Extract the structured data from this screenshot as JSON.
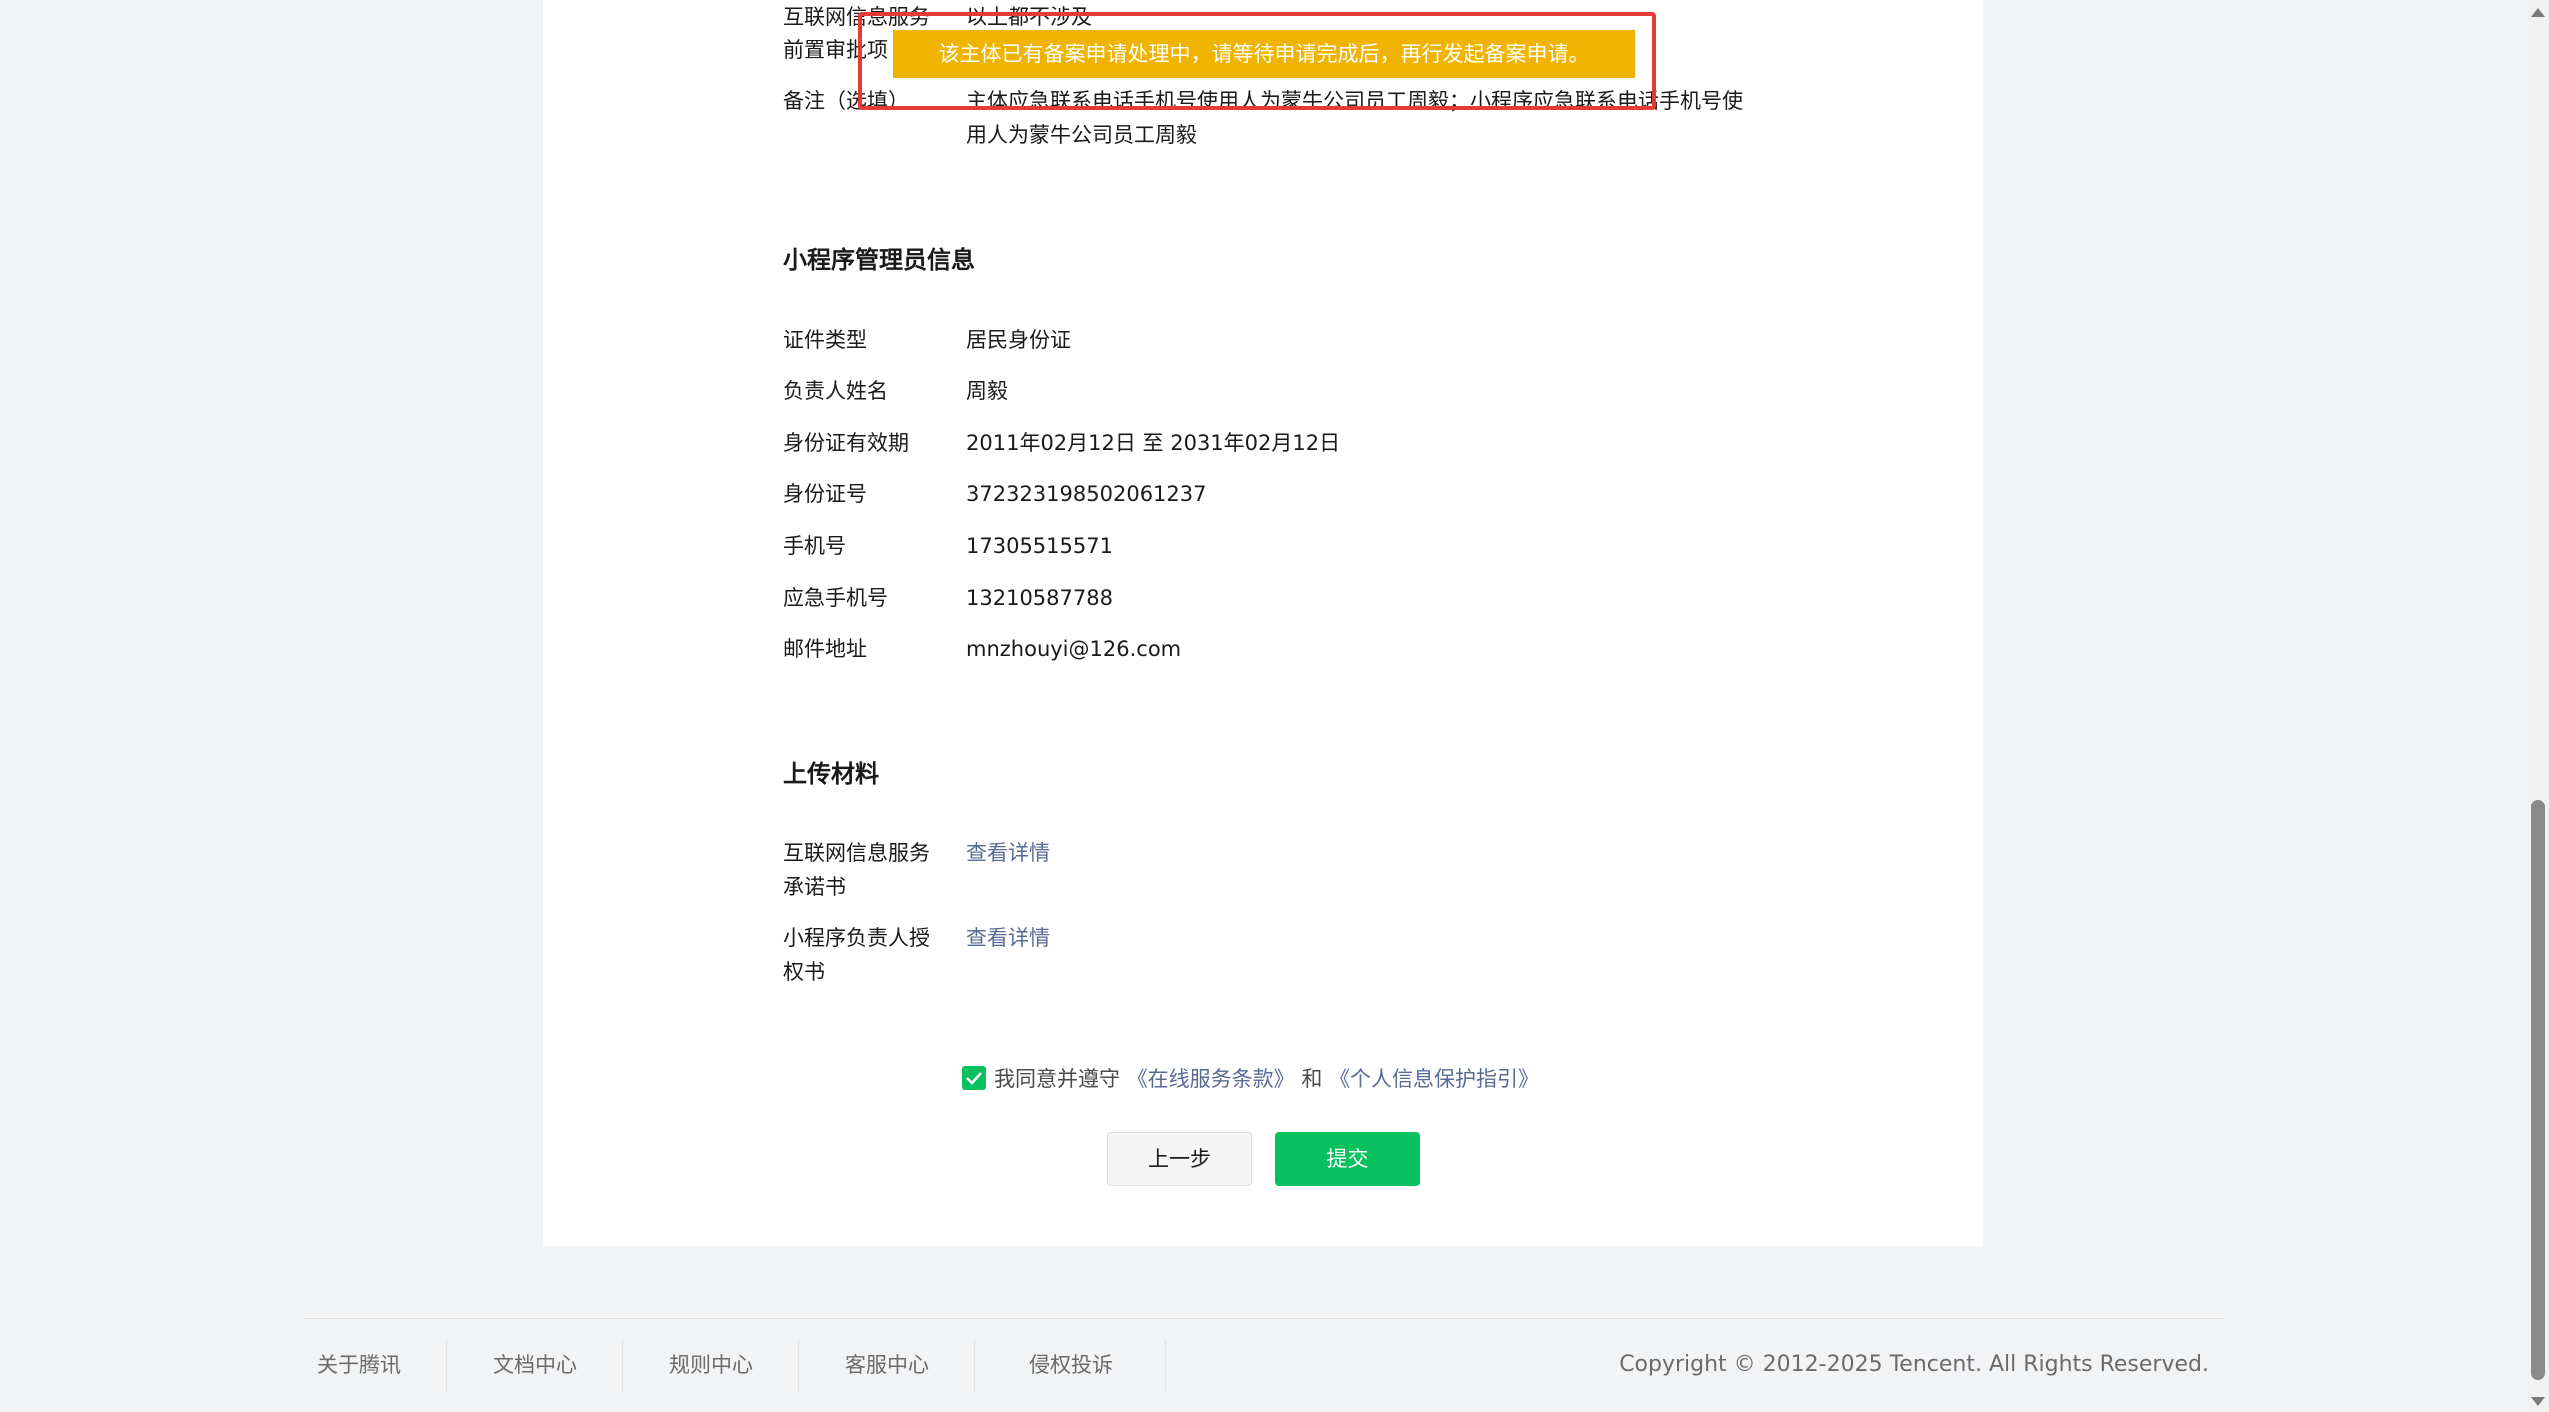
{
  "filing_info": {
    "internet_service": {
      "label": "互联网信息服务",
      "value": "以上都不涉及"
    },
    "pre_approval": {
      "label": "前置审批项"
    },
    "remarks": {
      "label": "备注（选填）",
      "value": "主体应急联系电话手机号使用人为蒙牛公司员工周毅；小程序应急联系电话手机号使用人为蒙牛公司员工周毅"
    }
  },
  "toast": {
    "message": "该主体已有备案申请处理中，请等待申请完成后，再行发起备案申请。"
  },
  "admin_section": {
    "title": "小程序管理员信息",
    "fields": [
      {
        "label": "证件类型",
        "value": "居民身份证"
      },
      {
        "label": "负责人姓名",
        "value": "周毅"
      },
      {
        "label": "身份证有效期",
        "value": "2011年02月12日 至 2031年02月12日"
      },
      {
        "label": "身份证号",
        "value": "372323198502061237"
      },
      {
        "label": "手机号",
        "value": "17305515571"
      },
      {
        "label": "应急手机号",
        "value": "13210587788"
      },
      {
        "label": "邮件地址",
        "value": "mnzhouyi@126.com"
      }
    ]
  },
  "upload_section": {
    "title": "上传材料",
    "items": [
      {
        "label": "互联网信息服务承诺书",
        "link": "查看详情"
      },
      {
        "label": "小程序负责人授权书",
        "link": "查看详情"
      }
    ]
  },
  "agreement": {
    "checked": true,
    "prefix": "我同意并遵守",
    "terms_link": "《在线服务条款》",
    "conjunction": "和",
    "privacy_link": "《个人信息保护指引》"
  },
  "buttons": {
    "prev": "上一步",
    "submit": "提交"
  },
  "footer": {
    "links": [
      "关于腾讯",
      "文档中心",
      "规则中心",
      "客服中心",
      "侵权投诉"
    ],
    "copyright": "Copyright © 2012-2025 Tencent. All Rights Reserved."
  },
  "colors": {
    "accent": "#07c160",
    "warning": "#f0b400",
    "highlight": "#e63939",
    "link": "#576b95"
  }
}
